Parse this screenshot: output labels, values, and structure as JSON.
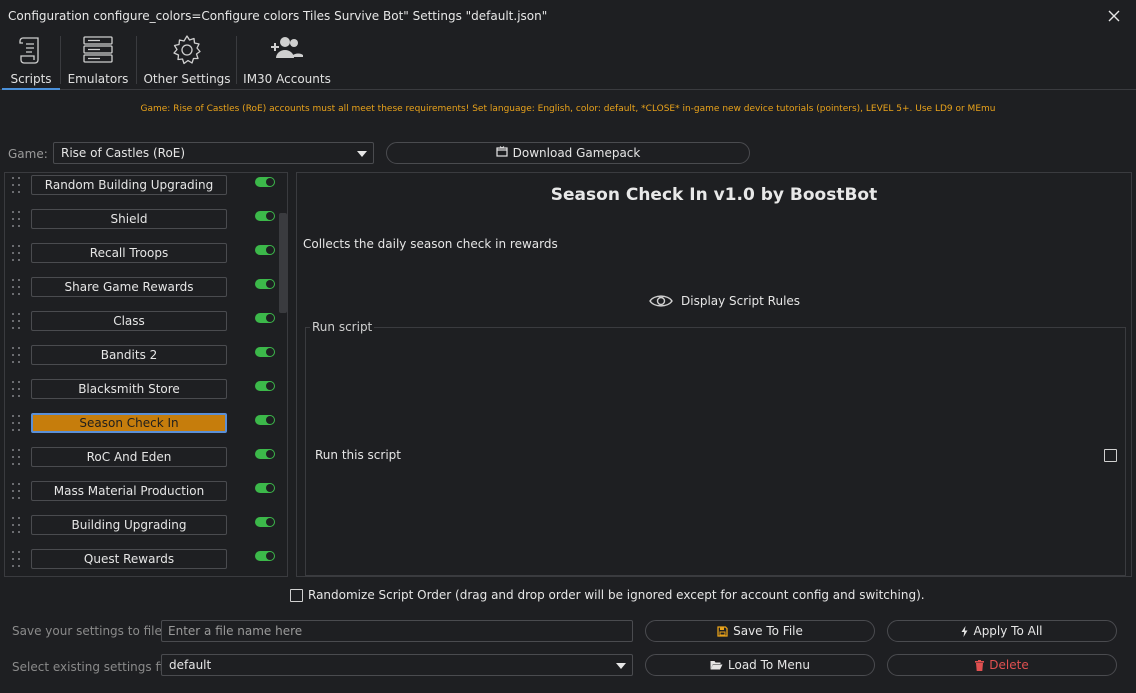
{
  "window": {
    "title": "Configuration configure_colors=Configure colors Tiles Survive Bot\" Settings \"default.json\""
  },
  "toolbar": {
    "items": [
      {
        "label": "Scripts",
        "icon": "scroll-icon"
      },
      {
        "label": "Emulators",
        "icon": "server-icon"
      },
      {
        "label": "Other Settings",
        "icon": "gear-icon"
      },
      {
        "label": "IM30 Accounts",
        "icon": "users-add-icon"
      }
    ],
    "active": "Scripts"
  },
  "notice": "Game: Rise of Castles (RoE) accounts must all meet these requirements! Set language: English, color: default, *CLOSE* in-game new device tutorials (pointers), LEVEL 5+. Use LD9 or MEmu",
  "game": {
    "label": "Game:",
    "selected": "Rise of Castles (RoE)",
    "download_label": "Download Gamepack"
  },
  "scripts": [
    {
      "label": "Random Building Upgrading",
      "enabled": true
    },
    {
      "label": "Shield",
      "enabled": true
    },
    {
      "label": "Recall Troops",
      "enabled": true
    },
    {
      "label": "Share Game Rewards",
      "enabled": true
    },
    {
      "label": "Class",
      "enabled": true
    },
    {
      "label": "Bandits 2",
      "enabled": true
    },
    {
      "label": "Blacksmith Store",
      "enabled": true
    },
    {
      "label": "Season Check In",
      "enabled": true,
      "active": true
    },
    {
      "label": "RoC And Eden",
      "enabled": true
    },
    {
      "label": "Mass Material Production",
      "enabled": true
    },
    {
      "label": "Building Upgrading",
      "enabled": true
    },
    {
      "label": "Quest Rewards",
      "enabled": true
    }
  ],
  "detail": {
    "title": "Season Check In v1.0 by BoostBot",
    "description": "Collects the daily season check in rewards",
    "rules_label": "Display Script Rules",
    "group_label": "Run script",
    "run_label": "Run this script",
    "run_checked": false
  },
  "randomize": {
    "label": "Randomize Script Order (drag and drop order will be ignored except for account config and switching).",
    "checked": false
  },
  "save": {
    "label": "Save your settings to file",
    "placeholder": "Enter a file name here",
    "button": "Save To File",
    "apply_all": "Apply To All"
  },
  "load": {
    "label": "Select existing settings file",
    "selected": "default",
    "button": "Load To Menu",
    "delete": "Delete"
  },
  "colors": {
    "accent": "#c67d0c",
    "toggle_on": "#3cb84a",
    "notice": "#e8a21b",
    "delete": "#e05050"
  }
}
